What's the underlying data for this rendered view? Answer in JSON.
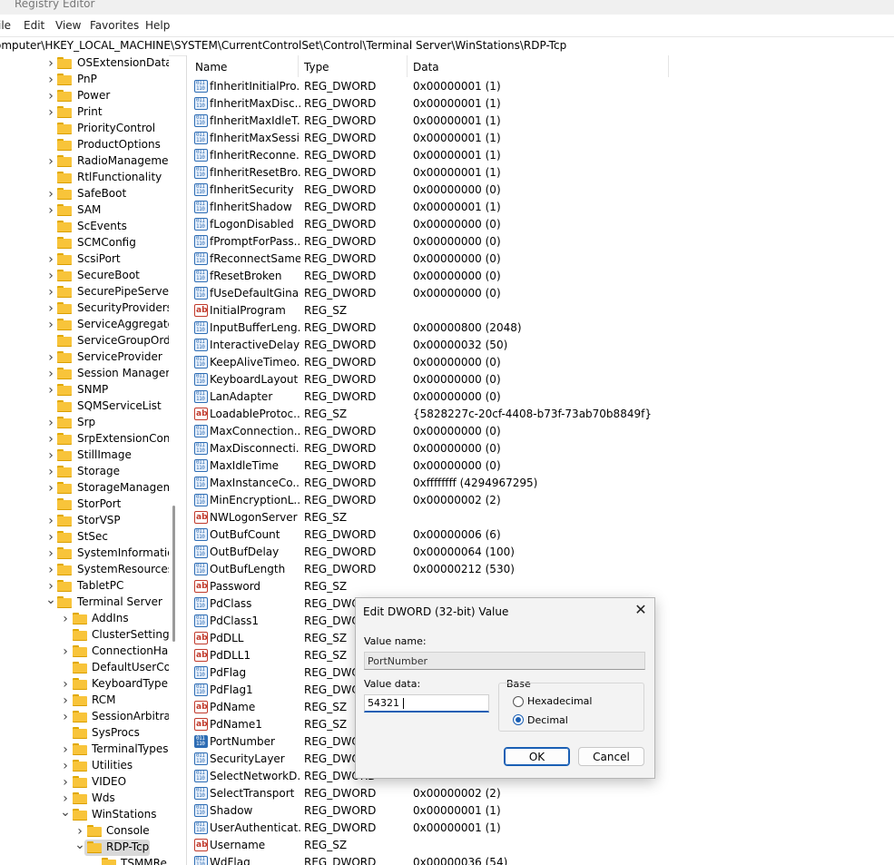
{
  "window": {
    "title": "Registry Editor"
  },
  "menu": [
    "ile",
    "Edit",
    "View",
    "Favorites",
    "Help"
  ],
  "address": "omputer\\HKEY_LOCAL_MACHINE\\SYSTEM\\CurrentControlSet\\Control\\Terminal Server\\WinStations\\RDP-Tcp",
  "tree": {
    "items": [
      {
        "label": "OSExtensionDataba",
        "level": 1,
        "expanded": false
      },
      {
        "label": "PnP",
        "level": 1,
        "expanded": false
      },
      {
        "label": "Power",
        "level": 1,
        "expanded": false
      },
      {
        "label": "Print",
        "level": 1,
        "expanded": false
      },
      {
        "label": "PriorityControl",
        "level": 1,
        "leaf": true
      },
      {
        "label": "ProductOptions",
        "level": 1,
        "leaf": true
      },
      {
        "label": "RadioManagement",
        "level": 1,
        "expanded": false
      },
      {
        "label": "RtlFunctionality",
        "level": 1,
        "leaf": true
      },
      {
        "label": "SafeBoot",
        "level": 1,
        "expanded": false
      },
      {
        "label": "SAM",
        "level": 1,
        "expanded": false
      },
      {
        "label": "ScEvents",
        "level": 1,
        "leaf": true
      },
      {
        "label": "SCMConfig",
        "level": 1,
        "leaf": true
      },
      {
        "label": "ScsiPort",
        "level": 1,
        "expanded": false
      },
      {
        "label": "SecureBoot",
        "level": 1,
        "expanded": false
      },
      {
        "label": "SecurePipeServers",
        "level": 1,
        "expanded": false
      },
      {
        "label": "SecurityProviders",
        "level": 1,
        "expanded": false
      },
      {
        "label": "ServiceAggregated",
        "level": 1,
        "expanded": false
      },
      {
        "label": "ServiceGroupOrder",
        "level": 1,
        "leaf": true
      },
      {
        "label": "ServiceProvider",
        "level": 1,
        "expanded": false
      },
      {
        "label": "Session Manager",
        "level": 1,
        "expanded": false
      },
      {
        "label": "SNMP",
        "level": 1,
        "expanded": false
      },
      {
        "label": "SQMServiceList",
        "level": 1,
        "leaf": true
      },
      {
        "label": "Srp",
        "level": 1,
        "expanded": false
      },
      {
        "label": "SrpExtensionConfig",
        "level": 1,
        "expanded": false
      },
      {
        "label": "StillImage",
        "level": 1,
        "expanded": false
      },
      {
        "label": "Storage",
        "level": 1,
        "expanded": false
      },
      {
        "label": "StorageManageme",
        "level": 1,
        "expanded": false
      },
      {
        "label": "StorPort",
        "level": 1,
        "leaf": true
      },
      {
        "label": "StorVSP",
        "level": 1,
        "expanded": false
      },
      {
        "label": "StSec",
        "level": 1,
        "expanded": false
      },
      {
        "label": "SystemInformation",
        "level": 1,
        "expanded": false
      },
      {
        "label": "SystemResources",
        "level": 1,
        "expanded": false
      },
      {
        "label": "TabletPC",
        "level": 1,
        "expanded": false
      },
      {
        "label": "Terminal Server",
        "level": 1,
        "expanded": true
      },
      {
        "label": "AddIns",
        "level": 2,
        "expanded": false
      },
      {
        "label": "ClusterSettings",
        "level": 2,
        "leaf": true
      },
      {
        "label": "ConnectionHan",
        "level": 2,
        "expanded": false
      },
      {
        "label": "DefaultUserCon",
        "level": 2,
        "leaf": true
      },
      {
        "label": "KeyboardType M",
        "level": 2,
        "expanded": false
      },
      {
        "label": "RCM",
        "level": 2,
        "expanded": false
      },
      {
        "label": "SessionArbitrati",
        "level": 2,
        "expanded": false
      },
      {
        "label": "SysProcs",
        "level": 2,
        "leaf": true
      },
      {
        "label": "TerminalTypes",
        "level": 2,
        "expanded": false
      },
      {
        "label": "Utilities",
        "level": 2,
        "expanded": false
      },
      {
        "label": "VIDEO",
        "level": 2,
        "expanded": false
      },
      {
        "label": "Wds",
        "level": 2,
        "expanded": false
      },
      {
        "label": "WinStations",
        "level": 2,
        "expanded": true
      },
      {
        "label": "Console",
        "level": 3,
        "expanded": false
      },
      {
        "label": "RDP-Tcp",
        "level": 3,
        "expanded": true,
        "selected": true
      },
      {
        "label": "TSMMRe",
        "level": 4,
        "leaf": true
      }
    ]
  },
  "list": {
    "columns": [
      "Name",
      "Type",
      "Data"
    ],
    "rows": [
      {
        "name": "fInheritInitialPro...",
        "type": "REG_DWORD",
        "data": "0x00000001 (1)",
        "icon": "binary"
      },
      {
        "name": "fInheritMaxDisc...",
        "type": "REG_DWORD",
        "data": "0x00000001 (1)",
        "icon": "binary"
      },
      {
        "name": "fInheritMaxIdleT...",
        "type": "REG_DWORD",
        "data": "0x00000001 (1)",
        "icon": "binary"
      },
      {
        "name": "fInheritMaxSessi...",
        "type": "REG_DWORD",
        "data": "0x00000001 (1)",
        "icon": "binary"
      },
      {
        "name": "fInheritReconne...",
        "type": "REG_DWORD",
        "data": "0x00000001 (1)",
        "icon": "binary"
      },
      {
        "name": "fInheritResetBro...",
        "type": "REG_DWORD",
        "data": "0x00000001 (1)",
        "icon": "binary"
      },
      {
        "name": "fInheritSecurity",
        "type": "REG_DWORD",
        "data": "0x00000000 (0)",
        "icon": "binary"
      },
      {
        "name": "fInheritShadow",
        "type": "REG_DWORD",
        "data": "0x00000001 (1)",
        "icon": "binary"
      },
      {
        "name": "fLogonDisabled",
        "type": "REG_DWORD",
        "data": "0x00000000 (0)",
        "icon": "binary"
      },
      {
        "name": "fPromptForPass...",
        "type": "REG_DWORD",
        "data": "0x00000000 (0)",
        "icon": "binary"
      },
      {
        "name": "fReconnectSame",
        "type": "REG_DWORD",
        "data": "0x00000000 (0)",
        "icon": "binary"
      },
      {
        "name": "fResetBroken",
        "type": "REG_DWORD",
        "data": "0x00000000 (0)",
        "icon": "binary"
      },
      {
        "name": "fUseDefaultGina",
        "type": "REG_DWORD",
        "data": "0x00000000 (0)",
        "icon": "binary"
      },
      {
        "name": "InitialProgram",
        "type": "REG_SZ",
        "data": "",
        "icon": "string"
      },
      {
        "name": "InputBufferLeng...",
        "type": "REG_DWORD",
        "data": "0x00000800 (2048)",
        "icon": "binary"
      },
      {
        "name": "InteractiveDelay",
        "type": "REG_DWORD",
        "data": "0x00000032 (50)",
        "icon": "binary"
      },
      {
        "name": "KeepAliveTimeo...",
        "type": "REG_DWORD",
        "data": "0x00000000 (0)",
        "icon": "binary"
      },
      {
        "name": "KeyboardLayout",
        "type": "REG_DWORD",
        "data": "0x00000000 (0)",
        "icon": "binary"
      },
      {
        "name": "LanAdapter",
        "type": "REG_DWORD",
        "data": "0x00000000 (0)",
        "icon": "binary"
      },
      {
        "name": "LoadableProtoc...",
        "type": "REG_SZ",
        "data": "{5828227c-20cf-4408-b73f-73ab70b8849f}",
        "icon": "string"
      },
      {
        "name": "MaxConnection...",
        "type": "REG_DWORD",
        "data": "0x00000000 (0)",
        "icon": "binary"
      },
      {
        "name": "MaxDisconnecti...",
        "type": "REG_DWORD",
        "data": "0x00000000 (0)",
        "icon": "binary"
      },
      {
        "name": "MaxIdleTime",
        "type": "REG_DWORD",
        "data": "0x00000000 (0)",
        "icon": "binary"
      },
      {
        "name": "MaxInstanceCo...",
        "type": "REG_DWORD",
        "data": "0xffffffff (4294967295)",
        "icon": "binary"
      },
      {
        "name": "MinEncryptionL...",
        "type": "REG_DWORD",
        "data": "0x00000002 (2)",
        "icon": "binary"
      },
      {
        "name": "NWLogonServer",
        "type": "REG_SZ",
        "data": "",
        "icon": "string"
      },
      {
        "name": "OutBufCount",
        "type": "REG_DWORD",
        "data": "0x00000006 (6)",
        "icon": "binary"
      },
      {
        "name": "OutBufDelay",
        "type": "REG_DWORD",
        "data": "0x00000064 (100)",
        "icon": "binary"
      },
      {
        "name": "OutBufLength",
        "type": "REG_DWORD",
        "data": "0x00000212 (530)",
        "icon": "binary"
      },
      {
        "name": "Password",
        "type": "REG_SZ",
        "data": "",
        "icon": "string"
      },
      {
        "name": "PdClass",
        "type": "REG_DWORD",
        "data": "",
        "icon": "binary"
      },
      {
        "name": "PdClass1",
        "type": "REG_DWORD",
        "data": "",
        "icon": "binary"
      },
      {
        "name": "PdDLL",
        "type": "REG_SZ",
        "data": "",
        "icon": "string"
      },
      {
        "name": "PdDLL1",
        "type": "REG_SZ",
        "data": "",
        "icon": "string"
      },
      {
        "name": "PdFlag",
        "type": "REG_DWORD",
        "data": "",
        "icon": "binary"
      },
      {
        "name": "PdFlag1",
        "type": "REG_DWORD",
        "data": "",
        "icon": "binary"
      },
      {
        "name": "PdName",
        "type": "REG_SZ",
        "data": "",
        "icon": "string"
      },
      {
        "name": "PdName1",
        "type": "REG_SZ",
        "data": "",
        "icon": "string"
      },
      {
        "name": "PortNumber",
        "type": "REG_DWORD",
        "data": "",
        "icon": "binary",
        "highlight": true
      },
      {
        "name": "SecurityLayer",
        "type": "REG_DWORD",
        "data": "",
        "icon": "binary"
      },
      {
        "name": "SelectNetworkD...",
        "type": "REG_DWORD",
        "data": "",
        "icon": "binary"
      },
      {
        "name": "SelectTransport",
        "type": "REG_DWORD",
        "data": "0x00000002 (2)",
        "icon": "binary"
      },
      {
        "name": "Shadow",
        "type": "REG_DWORD",
        "data": "0x00000001 (1)",
        "icon": "binary"
      },
      {
        "name": "UserAuthenticat...",
        "type": "REG_DWORD",
        "data": "0x00000001 (1)",
        "icon": "binary"
      },
      {
        "name": "Username",
        "type": "REG_SZ",
        "data": "",
        "icon": "string"
      },
      {
        "name": "WdFlag",
        "type": "REG_DWORD",
        "data": "0x00000036 (54)",
        "icon": "binary"
      }
    ]
  },
  "dialog": {
    "title": "Edit DWORD (32-bit) Value",
    "value_name_label": "Value name:",
    "value_name": "PortNumber",
    "value_data_label": "Value data:",
    "value_data": "54321",
    "base_label": "Base",
    "hex_label": "Hexadecimal",
    "dec_label": "Decimal",
    "selected_base": "Decimal",
    "ok_label": "OK",
    "cancel_label": "Cancel",
    "close_glyph": "✕"
  },
  "colors": {
    "accent": "#1a5fb4",
    "folder": "#f8c43a",
    "selection": "#d9d9d9"
  }
}
